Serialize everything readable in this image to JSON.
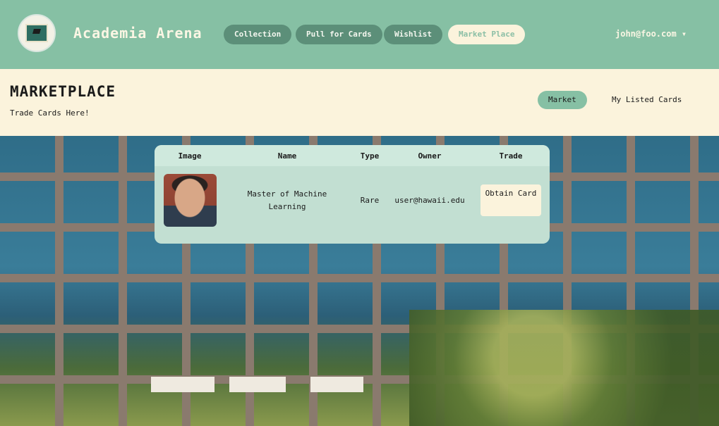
{
  "navbar": {
    "brand": "Academia Arena",
    "logo_text": "ACADEMIA ARENA",
    "links": [
      "Collection",
      "Pull for Cards",
      "Wishlist",
      "Market Place"
    ],
    "active_link": "Market Place",
    "user": "john@foo.com ▾"
  },
  "header": {
    "title": "MARKETPLACE",
    "subtitle": "Trade Cards Here!",
    "tabs": [
      "Market",
      "My Listed Cards"
    ],
    "active_tab": "Market"
  },
  "table": {
    "columns": [
      "Image",
      "Name",
      "Type",
      "Owner",
      "Trade"
    ],
    "rows": [
      {
        "image": "professor-portrait",
        "name": "Master of Machine Learning",
        "type": "Rare",
        "owner": "user@hawaii.edu",
        "trade_label": "Obtain Card"
      }
    ]
  },
  "colors": {
    "navbar": "#86c0a4",
    "nav_button": "#5c8f79",
    "cream": "#fbf3dc",
    "table_header": "#cfe9dd",
    "table_body": "#c2dfd2"
  }
}
